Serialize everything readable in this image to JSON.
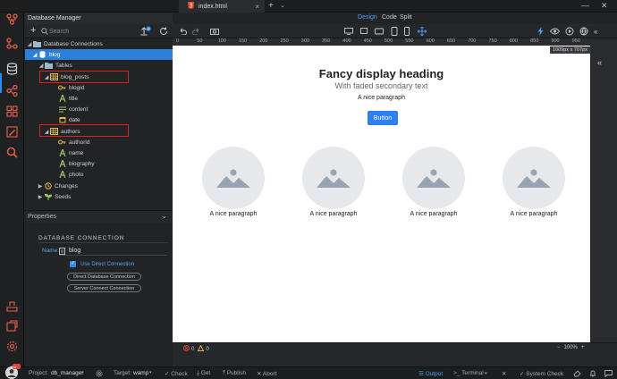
{
  "topbar": {
    "tab_title": "index.html",
    "close_glyph": "×",
    "plus_glyph": "+",
    "dropdown_glyph": "⌄",
    "minimize_glyph": "—",
    "close_window_glyph": "✕"
  },
  "panel": {
    "title": "Database Manager",
    "search_placeholder": "Search",
    "badge": "0"
  },
  "tree": {
    "root": "Database Connections",
    "db": "blog",
    "tables": "Tables",
    "table1": "blog_posts",
    "t1_fields": [
      "blogid",
      "title",
      "content",
      "date"
    ],
    "table2": "authors",
    "t2_fields": [
      "authorid",
      "name",
      "biography",
      "photo"
    ],
    "changes": "Changes",
    "seeds": "Seeds"
  },
  "properties": {
    "title": "Properties",
    "section": "DATABASE CONNECTION",
    "name_label": "Name",
    "name_value": "blog",
    "use_direct": "Use Direct Connection",
    "btn_direct": "Direct Database Connection",
    "btn_server": "Server Connect Connection"
  },
  "design": {
    "modes": [
      "Design",
      "Code",
      "Split"
    ],
    "size_badge": "1009px x 707px",
    "ruler_ticks": [
      "0",
      "50",
      "100",
      "150",
      "200",
      "250",
      "300",
      "350",
      "400",
      "450",
      "500",
      "550",
      "600",
      "650",
      "700",
      "750",
      "800",
      "850",
      "900",
      "950",
      "1"
    ],
    "heading": "Fancy display heading",
    "subheading": "With faded secondary text",
    "paragraph": "A nice paragraph",
    "button": "Button",
    "cards": [
      "A nice paragraph",
      "A nice paragraph",
      "A nice paragraph",
      "A nice paragraph"
    ],
    "errors": "0",
    "warnings": "0",
    "zoom": "100%",
    "zoom_minus": "−",
    "zoom_plus": "+"
  },
  "bottombar": {
    "project_label": "Project:",
    "project": "db_manager",
    "target_label": "Target:",
    "target": "wamp",
    "check": "Check",
    "get": "Get",
    "publish": "Publish",
    "abort": "Abort",
    "output": "Output",
    "terminal": "Terminal",
    "system_check": "System Check",
    "user_badge": "Pro"
  },
  "colors": {
    "accent": "#2e8cf0",
    "selection": "#2e7fd9",
    "highlight_box": "#e01f1f",
    "button": "#2f7ff0"
  }
}
